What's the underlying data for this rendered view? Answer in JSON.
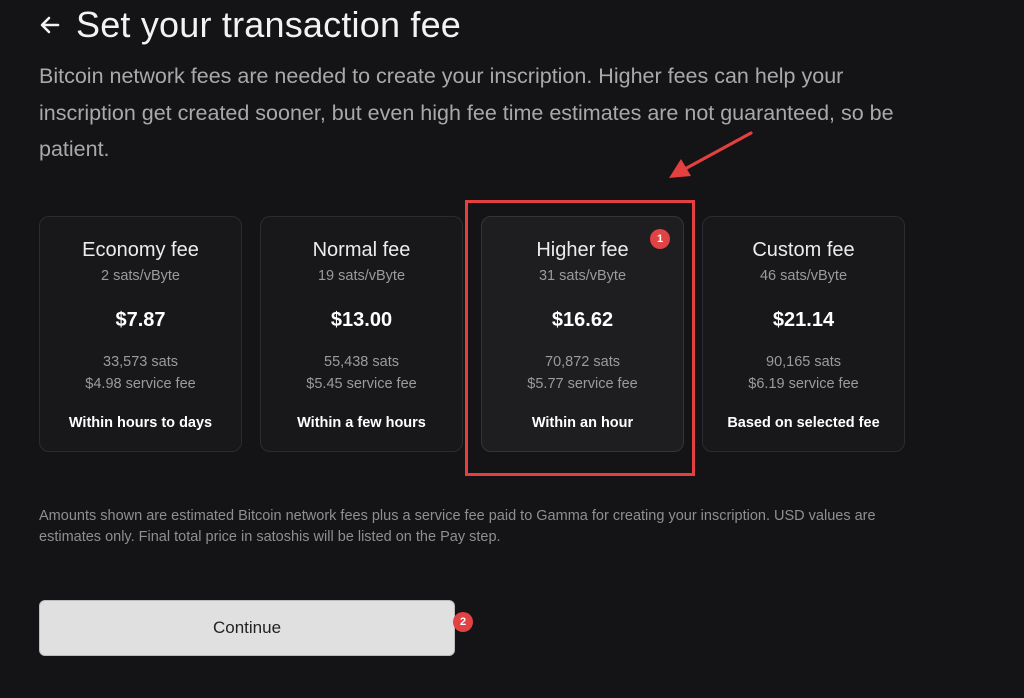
{
  "header": {
    "back_icon": "arrow-left-icon",
    "title": "Set your transaction fee"
  },
  "description": "Bitcoin network fees are needed to create your inscription. Higher fees can help your inscription get created sooner, but even high fee time estimates are not guaranteed, so be patient.",
  "fee_options": [
    {
      "name": "Economy fee",
      "rate": "2 sats/vByte",
      "usd": "$7.87",
      "sats": "33,573 sats",
      "service_fee": "$4.98 service fee",
      "time": "Within hours to days",
      "selected": false
    },
    {
      "name": "Normal fee",
      "rate": "19 sats/vByte",
      "usd": "$13.00",
      "sats": "55,438 sats",
      "service_fee": "$5.45 service fee",
      "time": "Within a few hours",
      "selected": false
    },
    {
      "name": "Higher fee",
      "rate": "31 sats/vByte",
      "usd": "$16.62",
      "sats": "70,872 sats",
      "service_fee": "$5.77 service fee",
      "time": "Within an hour",
      "selected": true
    },
    {
      "name": "Custom fee",
      "rate": "46 sats/vByte",
      "usd": "$21.14",
      "sats": "90,165 sats",
      "service_fee": "$6.19 service fee",
      "time": "Based on selected fee",
      "selected": false
    }
  ],
  "footnote": "Amounts shown are estimated Bitcoin network fees plus a service fee paid to Gamma for creating your inscription. USD values are estimates only. Final total price in satoshis will be listed on the Pay step.",
  "continue_label": "Continue",
  "annotations": {
    "step_1": "1",
    "step_2": "2",
    "color": "#e3403f"
  }
}
